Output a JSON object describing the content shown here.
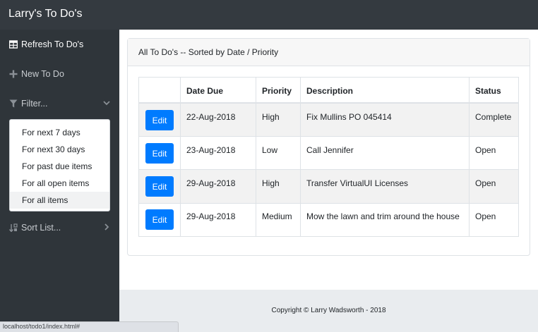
{
  "app": {
    "title": "Larry's To Do's"
  },
  "sidebar": {
    "items": [
      {
        "label": "Refresh To Do's",
        "icon": "table-icon",
        "active": true
      },
      {
        "label": "New To Do",
        "icon": "plus-icon"
      },
      {
        "label": "Filter...",
        "icon": "filter-icon",
        "chevron": "chevron-down-icon"
      },
      {
        "label": "Sort List...",
        "icon": "sort-icon",
        "chevron": "chevron-right-icon"
      }
    ],
    "filter_menu": [
      "For next 7 days",
      "For next 30 days",
      "For past due items",
      "For all open items",
      "For all items"
    ]
  },
  "card": {
    "header": "All To Do's -- Sorted by Date / Priority"
  },
  "table": {
    "columns": [
      "",
      "Date Due",
      "Priority",
      "Description",
      "Status"
    ],
    "rows": [
      {
        "action": "Edit",
        "date": "22-Aug-2018",
        "priority": "High",
        "description": "Fix Mullins PO 045414",
        "status": "Complete"
      },
      {
        "action": "Edit",
        "date": "23-Aug-2018",
        "priority": "Low",
        "description": "Call Jennifer",
        "status": "Open"
      },
      {
        "action": "Edit",
        "date": "29-Aug-2018",
        "priority": "High",
        "description": "Transfer VirtualUI Licenses",
        "status": "Open"
      },
      {
        "action": "Edit",
        "date": "29-Aug-2018",
        "priority": "Medium",
        "description": "Mow the lawn and trim around the house",
        "status": "Open"
      }
    ]
  },
  "footer": {
    "text": "Copyright © Larry Wadsworth - 2018"
  },
  "status_bar": {
    "url": "localhost/todo1/index.html#"
  },
  "colors": {
    "navbar": "#343a40",
    "sidebar": "#2f353a",
    "primary": "#007bff",
    "footer": "#e9ecef"
  }
}
